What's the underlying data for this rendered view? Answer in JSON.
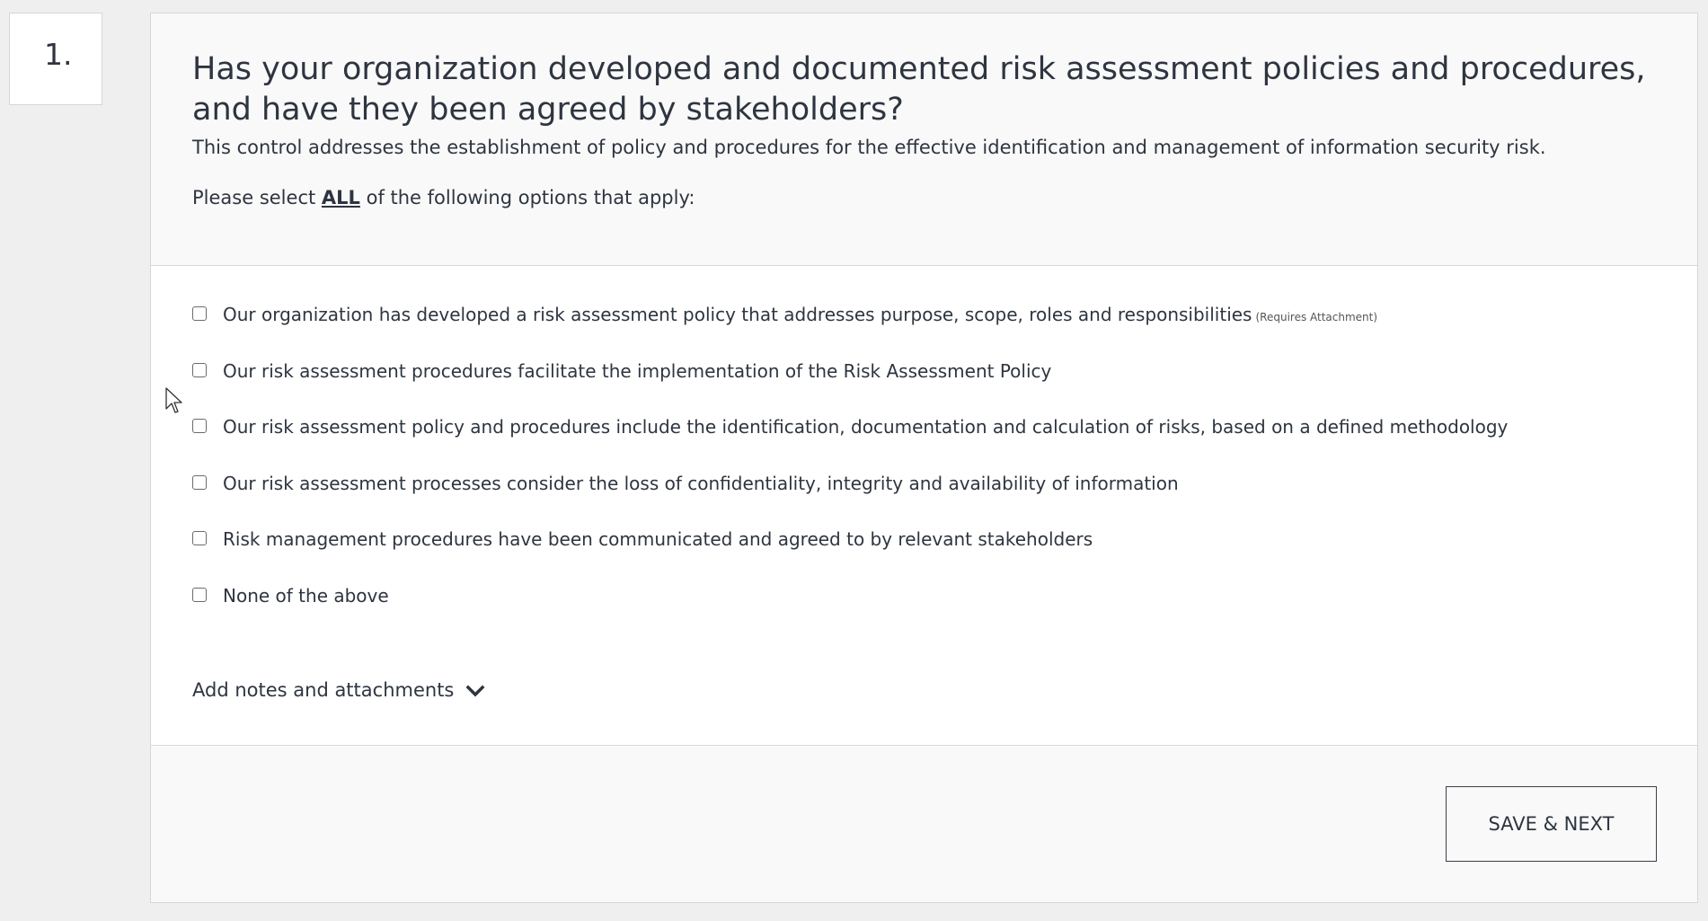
{
  "question": {
    "number": "1.",
    "title": "Has your organization developed and documented risk assessment policies and procedures, and have they been agreed by stakeholders?",
    "description": "This control addresses the establishment of policy and procedures for the effective identification and management of information security risk.",
    "prompt_before": "Please select ",
    "prompt_emphasis": "ALL",
    "prompt_after": " of the following options that apply:"
  },
  "options": [
    {
      "label": "Our organization has developed a risk assessment policy that addresses purpose, scope, roles and responsibilities",
      "note": "(Requires Attachment)",
      "checked": false
    },
    {
      "label": "Our risk assessment procedures facilitate the implementation of the Risk Assessment Policy",
      "checked": false
    },
    {
      "label": "Our risk assessment policy and procedures include the identification, documentation and calculation of risks, based on a defined methodology",
      "checked": false
    },
    {
      "label": "Our risk assessment processes consider the loss of confidentiality, integrity and availability of information",
      "checked": false
    },
    {
      "label": "Risk management procedures have been communicated and agreed to by relevant stakeholders",
      "checked": false
    },
    {
      "label": "None of the above",
      "checked": false
    }
  ],
  "notes": {
    "label": "Add notes and attachments",
    "icon": "chevron-down-icon"
  },
  "footer": {
    "save_next_label": "SAVE & NEXT"
  }
}
